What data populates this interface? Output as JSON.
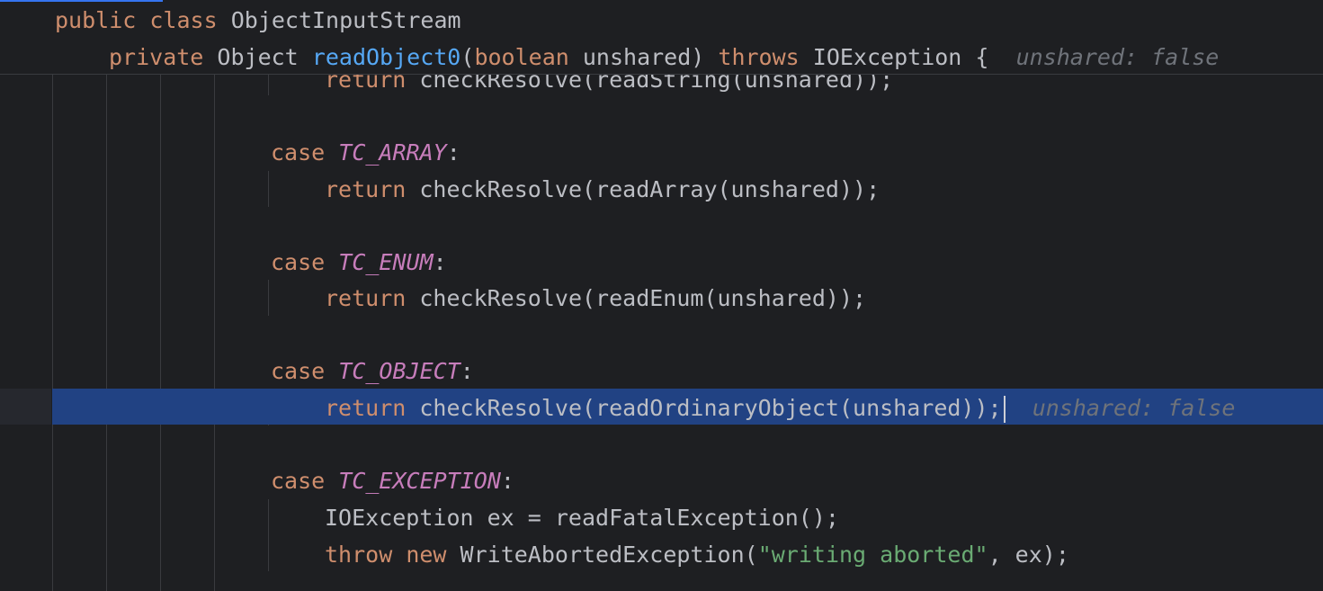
{
  "sticky": {
    "line1": {
      "kw1": "public",
      "kw2": "class",
      "name": "ObjectInputStream"
    },
    "line2": {
      "kw1": "private",
      "type": "Object",
      "method": "readObject0",
      "open_paren": "(",
      "param_type": "boolean",
      "param_name": "unshared",
      "close_paren": ")",
      "throws": "throws",
      "exception": "IOException",
      "brace": "{",
      "hint": "unshared: false"
    }
  },
  "code": {
    "partial_line": {
      "kw": "return",
      "text": "checkResolve(readString(unshared));"
    },
    "case_array": {
      "kw": "case",
      "const": "TC_ARRAY",
      "colon": ":"
    },
    "return_array": {
      "kw": "return",
      "text": "checkResolve(readArray(unshared));"
    },
    "case_enum": {
      "kw": "case",
      "const": "TC_ENUM",
      "colon": ":"
    },
    "return_enum": {
      "kw": "return",
      "text": "checkResolve(readEnum(unshared));"
    },
    "case_object": {
      "kw": "case",
      "const": "TC_OBJECT",
      "colon": ":"
    },
    "return_object": {
      "kw": "return",
      "text": "checkResolve(readOrdinaryObject(unshared));",
      "hint": "unshared: false"
    },
    "case_exception": {
      "kw": "case",
      "const": "TC_EXCEPTION",
      "colon": ":"
    },
    "ioexception_line": {
      "text": "IOException ex = readFatalException();"
    },
    "throw_line": {
      "kw1": "throw",
      "kw2": "new",
      "class_name": "WriteAbortedException(",
      "string": "\"writing aborted\"",
      "rest": ", ex);"
    }
  },
  "colors": {
    "background": "#1e1f22",
    "keyword": "#cf8e6d",
    "method_decl": "#56a8f5",
    "constant": "#c77dbb",
    "string": "#6aab73",
    "text": "#bcbec4",
    "hint": "#6f737a",
    "selection": "#214283"
  }
}
